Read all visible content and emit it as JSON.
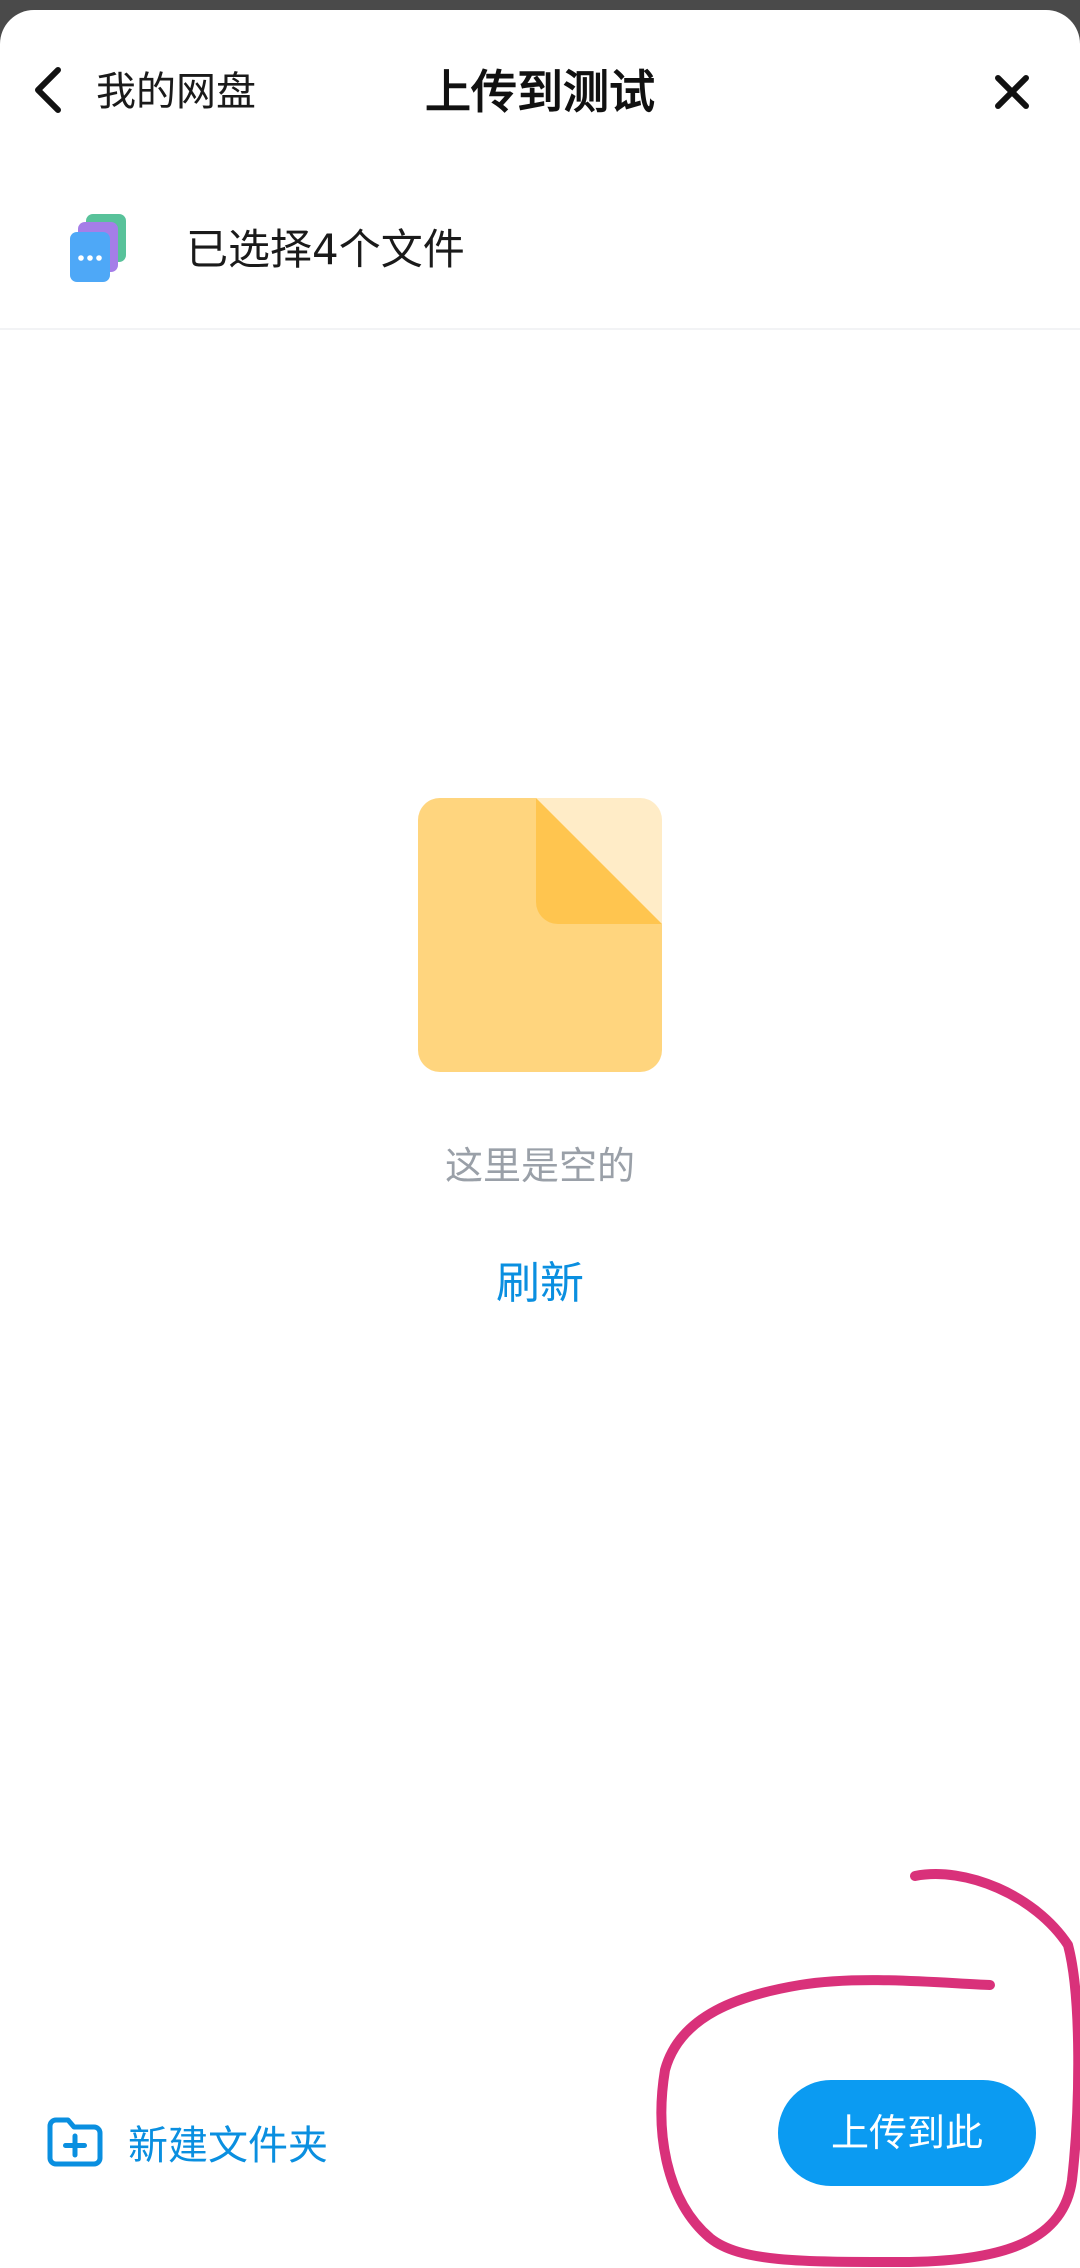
{
  "header": {
    "back_label": "我的网盘",
    "title": "上传到测试"
  },
  "selection": {
    "text": "已选择4个文件"
  },
  "empty_state": {
    "message": "这里是空的",
    "refresh_label": "刷新"
  },
  "footer": {
    "new_folder_label": "新建文件夹",
    "upload_label": "上传到此"
  },
  "icons": {
    "back": "chevron-left-icon",
    "close": "close-icon",
    "files": "stacked-files-icon",
    "empty": "empty-document-icon",
    "new_folder": "folder-plus-icon"
  },
  "colors": {
    "accent": "#0b9bf2",
    "link": "#0a8fe0",
    "muted_text": "#9aa0a8",
    "document_yellow": "#ffd57e",
    "annotation": "#d9317a"
  }
}
